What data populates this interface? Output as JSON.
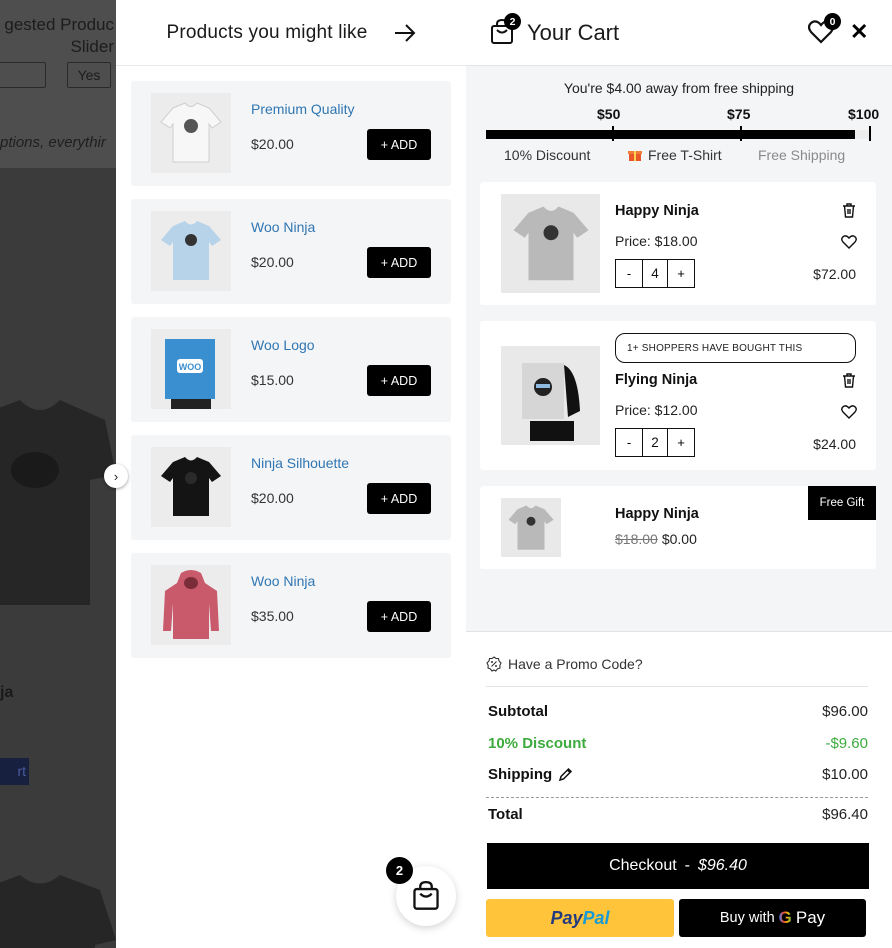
{
  "background_page": {
    "title_line1": "gested Produc",
    "title_line2": "Slider",
    "yes_label": "Yes",
    "options_text": "ptions, everythir",
    "product_name": "ja",
    "button_label": "rt"
  },
  "upsell": {
    "title": "Products you might like",
    "add_label": "+ ADD",
    "products": [
      {
        "name": "Premium Quality",
        "price": "$20.00",
        "icon": "white-tshirt-icon"
      },
      {
        "name": "Woo Ninja",
        "price": "$20.00",
        "icon": "blue-tshirt-icon"
      },
      {
        "name": "Woo Logo",
        "price": "$15.00",
        "icon": "woo-poster-icon"
      },
      {
        "name": "Ninja Silhouette",
        "price": "$20.00",
        "icon": "black-tshirt-icon"
      },
      {
        "name": "Woo Ninja",
        "price": "$35.00",
        "icon": "pink-hoodie-icon"
      }
    ]
  },
  "cart": {
    "title": "Your Cart",
    "item_count": "2",
    "wishlist_count": "0",
    "shipping_message": "You're $4.00 away from free shipping",
    "progress_percent": 96,
    "tiers": [
      {
        "amount": "$50",
        "label": "10% Discount",
        "reached": true
      },
      {
        "amount": "$75",
        "label": "Free T-Shirt",
        "reached": true
      },
      {
        "amount": "$100",
        "label": "Free Shipping",
        "reached": false
      }
    ],
    "items": [
      {
        "name": "Happy Ninja",
        "price": "Price: $18.00",
        "qty": "4",
        "total": "$72.00"
      },
      {
        "name": "Flying Ninja",
        "price": "Price: $12.00",
        "qty": "2",
        "total": "$24.00",
        "badge": "1+ SHOPPERS HAVE BOUGHT THIS"
      }
    ],
    "gift": {
      "name": "Happy Ninja",
      "old_price": "$18.00",
      "price": "$0.00",
      "badge": "Free Gift"
    },
    "qty_minus": "-",
    "qty_plus": "+"
  },
  "summary": {
    "promo_label": "Have a Promo Code?",
    "subtotal_label": "Subtotal",
    "subtotal": "$96.00",
    "discount_label": "10% Discount",
    "discount": "-$9.60",
    "shipping_label": "Shipping",
    "shipping": "$10.00",
    "total_label": "Total",
    "total": "$96.40",
    "checkout_label": "Checkout",
    "checkout_sep": "-",
    "checkout_amount": "$96.40",
    "paypal_a": "Pay",
    "paypal_b": "Pal",
    "gpay_prefix": "Buy with",
    "gpay_g": "G",
    "gpay_suffix": "Pay"
  },
  "float_cart": {
    "count": "2"
  },
  "colors": {
    "accent": "#000000",
    "link": "#2f76b2",
    "discount": "#3dab3d",
    "panel": "#f4f5f7",
    "paypal": "#ffc439"
  }
}
